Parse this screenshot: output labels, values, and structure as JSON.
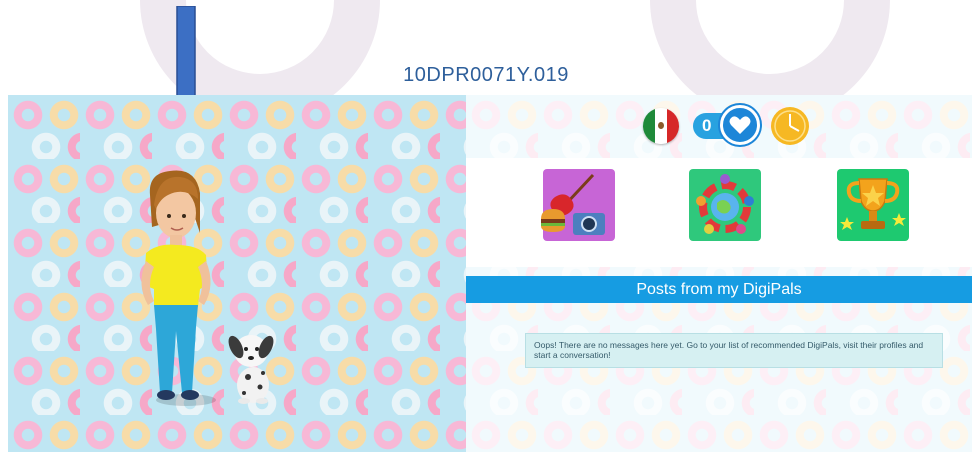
{
  "header": {
    "code": "10DPR0071Y.019"
  },
  "colors": {
    "accent_blue": "#169ce2",
    "arrow_blue": "#3c6fc4",
    "message_bg": "#d6f0f2"
  },
  "status": {
    "flag_icon": "mexico-flag-icon",
    "likes_count": "0",
    "heart_icon": "heart-icon",
    "clock_icon": "clock-icon"
  },
  "activities": [
    {
      "name": "music-food-photo-activity",
      "icon": "guitar-burger-camera-icon"
    },
    {
      "name": "world-friends-activity",
      "icon": "globe-people-icon"
    },
    {
      "name": "trophy-activity",
      "icon": "trophy-icon"
    }
  ],
  "posts": {
    "title": "Posts from my DigiPals",
    "empty_message": "Oops! There are no messages here yet. Go to your list of recommended DigiPals, visit their profiles and start a conversation!"
  }
}
